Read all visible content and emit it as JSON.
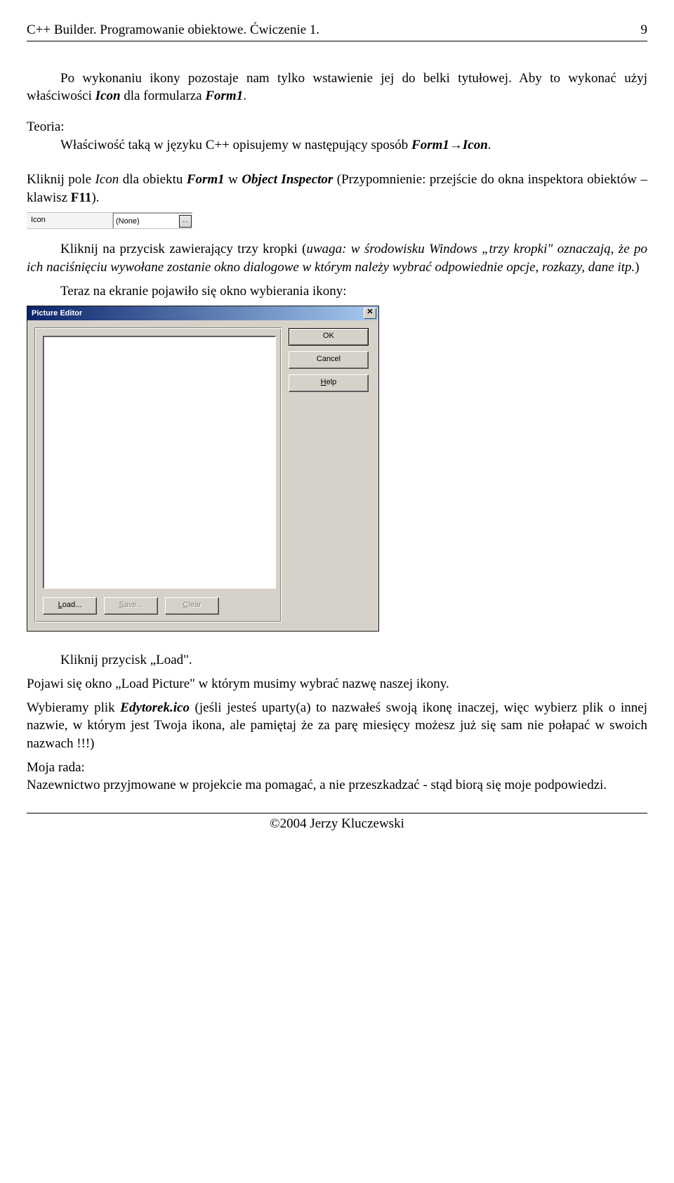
{
  "header": {
    "title": "C++ Builder. Programowanie obiektowe. Ćwiczenie 1.",
    "page_number": "9"
  },
  "body": {
    "p1a": "Po wykonaniu ikony pozostaje nam tylko wstawienie jej do belki tytułowej. Aby to wykonać użyj właściwości ",
    "p1b_bi": "Icon",
    "p1c": " dla formularza ",
    "p1d_bi": "Form1",
    "p1e": ".",
    "teoria_label": "Teoria:",
    "teoria_a": "Właściwość taką w języku C++ opisujemy w następujący sposób ",
    "teoria_b_bi": "Form1",
    "teoria_arrow": "→",
    "teoria_c_bi": "Icon",
    "teoria_d": ".",
    "p3a": "Kliknij pole ",
    "p3b_i": "Icon",
    "p3c": " dla obiektu ",
    "p3d_bi": "Form1",
    "p3e": " w ",
    "p3f_bi": "Object Inspector",
    "p3g": " (Przypomnienie: przejście do okna inspektora obiektów – klawisz ",
    "p3h_b": "F11",
    "p3i": ").",
    "p4a": "Kliknij na przycisk zawierający trzy kropki (",
    "p4b_i": "uwaga: w środowisku Windows „trzy kropki\" oznaczają, że po ich naciśnięciu wywołane zostanie okno dialogowe w którym należy wybrać odpowiednie opcje, rozkazy, dane itp.",
    "p4c": ")",
    "p5": "Teraz na ekranie pojawiło się okno wybierania ikony:",
    "p6": "Kliknij przycisk „Load\".",
    "p7": "Pojawi się okno „Load Picture\" w którym musimy wybrać nazwę naszej ikony.",
    "p8a": "Wybieramy plik ",
    "p8b_bi": "Edytorek.ico",
    "p8c": " (jeśli jesteś uparty(a) to nazwałeś swoją ikonę inaczej, więc wybierz plik o innej nazwie, w którym jest Twoja ikona, ale pamiętaj że za parę miesięcy możesz już się sam nie połapać w swoich nazwach !!!)",
    "p9_label": "Moja rada:",
    "p9": "Nazewnictwo przyjmowane w projekcie ma pomagać, a nie przeszkadzać - stąd biorą się moje podpowiedzi."
  },
  "inspector": {
    "property": "Icon",
    "value": "(None)",
    "ellipsis": "..."
  },
  "dialog": {
    "title": "Picture Editor",
    "close": "✕",
    "load_prefix": "L",
    "load_rest": "oad...",
    "save_prefix": "S",
    "save_rest": "ave...",
    "clear_prefix": "C",
    "clear_rest": "lear",
    "ok": "OK",
    "cancel": "Cancel",
    "help_prefix": "H",
    "help_rest": "elp"
  },
  "footer": {
    "copyright": "©2004 Jerzy Kluczewski"
  }
}
